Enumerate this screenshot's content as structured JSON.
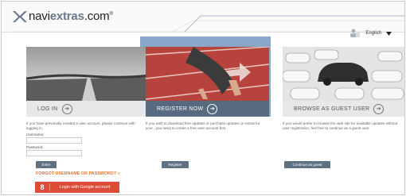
{
  "brand": {
    "name_part1": "navi",
    "name_part2": "extras",
    "name_part3": ".com",
    "mark": "®"
  },
  "language": {
    "selected": "English"
  },
  "panels": [
    {
      "title": "LOG IN",
      "description": "If you have previously created a user account, please continue with logging in."
    },
    {
      "title": "REGISTER NOW",
      "description": "If you wish to download free updates or purchase updates or extras for your , you need to create a free user account first."
    },
    {
      "title": "BROWSE AS GUEST USER",
      "description": "If you would prefer to browse the web site for available updates without user registration, feel free to continue as a guest user."
    }
  ],
  "login_form": {
    "username_label": "Username:",
    "password_label": "Password:"
  },
  "buttons": {
    "enter": "Enter",
    "register": "Register",
    "continue_guest": "Continue as guest",
    "forgot": "FORGOT USERNAME OR PASSWORD?",
    "forgot_arrow": "»",
    "google": "Login with Google account",
    "google_glyph": "8"
  }
}
